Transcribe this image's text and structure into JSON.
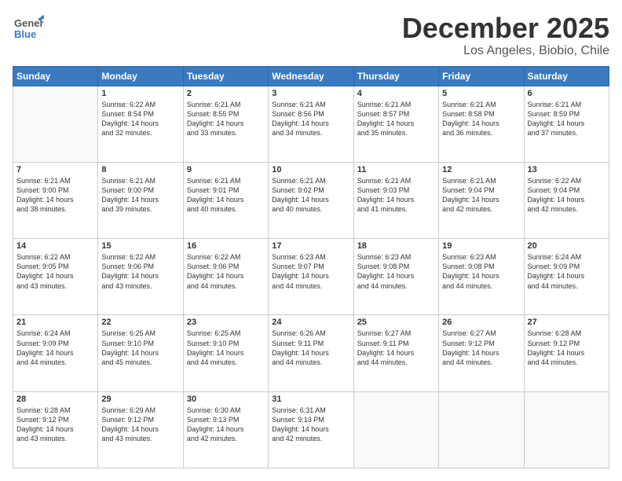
{
  "header": {
    "logo_general": "General",
    "logo_blue": "Blue",
    "month_title": "December 2025",
    "location": "Los Angeles, Biobio, Chile"
  },
  "days_of_week": [
    "Sunday",
    "Monday",
    "Tuesday",
    "Wednesday",
    "Thursday",
    "Friday",
    "Saturday"
  ],
  "weeks": [
    [
      {
        "day": "",
        "info": ""
      },
      {
        "day": "1",
        "info": "Sunrise: 6:22 AM\nSunset: 8:54 PM\nDaylight: 14 hours\nand 32 minutes."
      },
      {
        "day": "2",
        "info": "Sunrise: 6:21 AM\nSunset: 8:55 PM\nDaylight: 14 hours\nand 33 minutes."
      },
      {
        "day": "3",
        "info": "Sunrise: 6:21 AM\nSunset: 8:56 PM\nDaylight: 14 hours\nand 34 minutes."
      },
      {
        "day": "4",
        "info": "Sunrise: 6:21 AM\nSunset: 8:57 PM\nDaylight: 14 hours\nand 35 minutes."
      },
      {
        "day": "5",
        "info": "Sunrise: 6:21 AM\nSunset: 8:58 PM\nDaylight: 14 hours\nand 36 minutes."
      },
      {
        "day": "6",
        "info": "Sunrise: 6:21 AM\nSunset: 8:59 PM\nDaylight: 14 hours\nand 37 minutes."
      }
    ],
    [
      {
        "day": "7",
        "info": "Sunrise: 6:21 AM\nSunset: 9:00 PM\nDaylight: 14 hours\nand 38 minutes."
      },
      {
        "day": "8",
        "info": "Sunrise: 6:21 AM\nSunset: 9:00 PM\nDaylight: 14 hours\nand 39 minutes."
      },
      {
        "day": "9",
        "info": "Sunrise: 6:21 AM\nSunset: 9:01 PM\nDaylight: 14 hours\nand 40 minutes."
      },
      {
        "day": "10",
        "info": "Sunrise: 6:21 AM\nSunset: 9:02 PM\nDaylight: 14 hours\nand 40 minutes."
      },
      {
        "day": "11",
        "info": "Sunrise: 6:21 AM\nSunset: 9:03 PM\nDaylight: 14 hours\nand 41 minutes."
      },
      {
        "day": "12",
        "info": "Sunrise: 6:21 AM\nSunset: 9:04 PM\nDaylight: 14 hours\nand 42 minutes."
      },
      {
        "day": "13",
        "info": "Sunrise: 6:22 AM\nSunset: 9:04 PM\nDaylight: 14 hours\nand 42 minutes."
      }
    ],
    [
      {
        "day": "14",
        "info": "Sunrise: 6:22 AM\nSunset: 9:05 PM\nDaylight: 14 hours\nand 43 minutes."
      },
      {
        "day": "15",
        "info": "Sunrise: 6:22 AM\nSunset: 9:06 PM\nDaylight: 14 hours\nand 43 minutes."
      },
      {
        "day": "16",
        "info": "Sunrise: 6:22 AM\nSunset: 9:06 PM\nDaylight: 14 hours\nand 44 minutes."
      },
      {
        "day": "17",
        "info": "Sunrise: 6:23 AM\nSunset: 9:07 PM\nDaylight: 14 hours\nand 44 minutes."
      },
      {
        "day": "18",
        "info": "Sunrise: 6:23 AM\nSunset: 9:08 PM\nDaylight: 14 hours\nand 44 minutes."
      },
      {
        "day": "19",
        "info": "Sunrise: 6:23 AM\nSunset: 9:08 PM\nDaylight: 14 hours\nand 44 minutes."
      },
      {
        "day": "20",
        "info": "Sunrise: 6:24 AM\nSunset: 9:09 PM\nDaylight: 14 hours\nand 44 minutes."
      }
    ],
    [
      {
        "day": "21",
        "info": "Sunrise: 6:24 AM\nSunset: 9:09 PM\nDaylight: 14 hours\nand 44 minutes."
      },
      {
        "day": "22",
        "info": "Sunrise: 6:25 AM\nSunset: 9:10 PM\nDaylight: 14 hours\nand 45 minutes."
      },
      {
        "day": "23",
        "info": "Sunrise: 6:25 AM\nSunset: 9:10 PM\nDaylight: 14 hours\nand 44 minutes."
      },
      {
        "day": "24",
        "info": "Sunrise: 6:26 AM\nSunset: 9:11 PM\nDaylight: 14 hours\nand 44 minutes."
      },
      {
        "day": "25",
        "info": "Sunrise: 6:27 AM\nSunset: 9:11 PM\nDaylight: 14 hours\nand 44 minutes."
      },
      {
        "day": "26",
        "info": "Sunrise: 6:27 AM\nSunset: 9:12 PM\nDaylight: 14 hours\nand 44 minutes."
      },
      {
        "day": "27",
        "info": "Sunrise: 6:28 AM\nSunset: 9:12 PM\nDaylight: 14 hours\nand 44 minutes."
      }
    ],
    [
      {
        "day": "28",
        "info": "Sunrise: 6:28 AM\nSunset: 9:12 PM\nDaylight: 14 hours\nand 43 minutes."
      },
      {
        "day": "29",
        "info": "Sunrise: 6:29 AM\nSunset: 9:12 PM\nDaylight: 14 hours\nand 43 minutes."
      },
      {
        "day": "30",
        "info": "Sunrise: 6:30 AM\nSunset: 9:13 PM\nDaylight: 14 hours\nand 42 minutes."
      },
      {
        "day": "31",
        "info": "Sunrise: 6:31 AM\nSunset: 9:13 PM\nDaylight: 14 hours\nand 42 minutes."
      },
      {
        "day": "",
        "info": ""
      },
      {
        "day": "",
        "info": ""
      },
      {
        "day": "",
        "info": ""
      }
    ]
  ]
}
